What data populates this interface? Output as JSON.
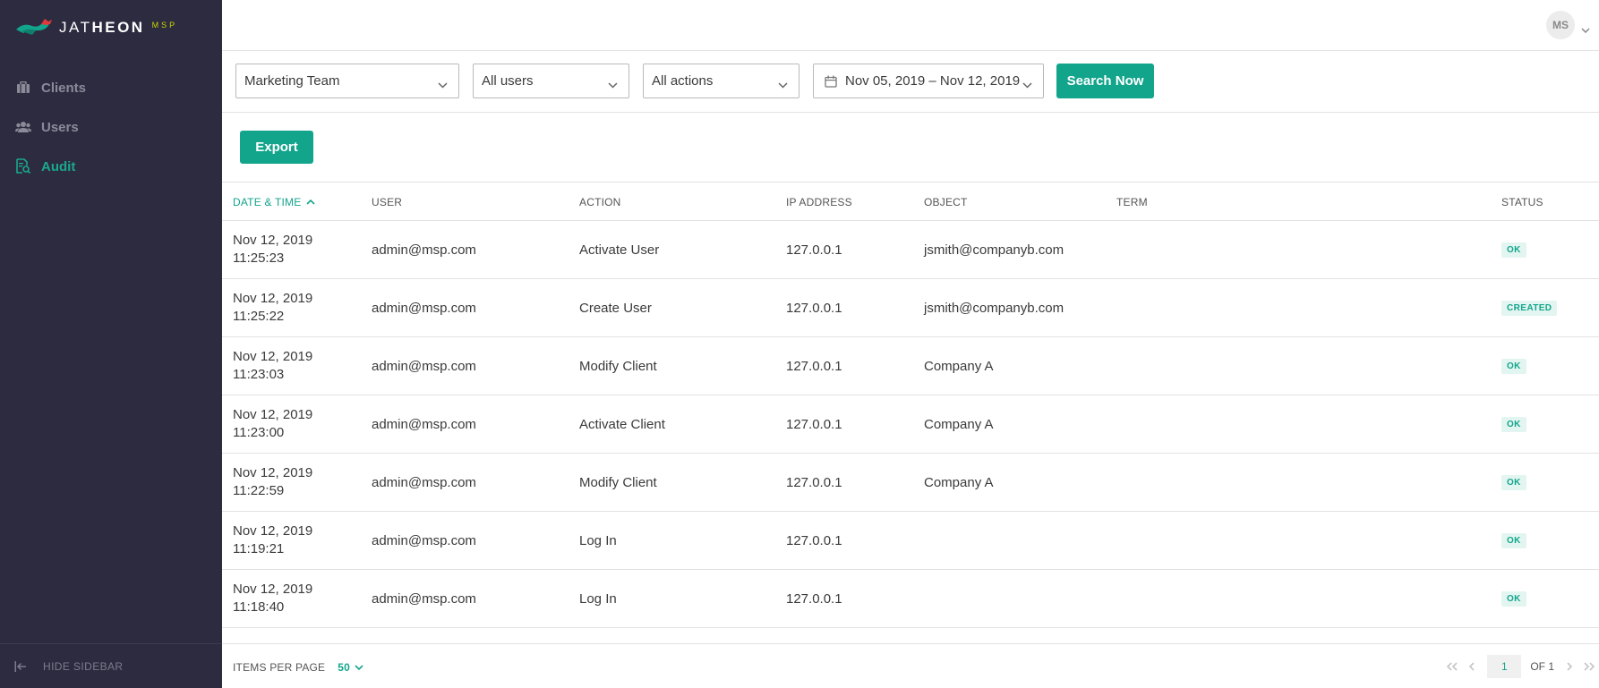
{
  "brand": {
    "name_light": "JAT",
    "name_bold": "HEON",
    "suffix": "MSP"
  },
  "sidebar": {
    "items": [
      {
        "label": "Clients",
        "icon": "briefcase-icon",
        "active": false
      },
      {
        "label": "Users",
        "icon": "users-icon",
        "active": false
      },
      {
        "label": "Audit",
        "icon": "audit-icon",
        "active": true
      }
    ],
    "hide_label": "HIDE SIDEBAR"
  },
  "header": {
    "avatar_initials": "MS"
  },
  "filters": {
    "team": "Marketing Team",
    "users": "All users",
    "actions": "All actions",
    "date_range": "Nov 05, 2019 – Nov 12, 2019",
    "search_label": "Search Now"
  },
  "toolbar": {
    "export_label": "Export"
  },
  "table": {
    "columns": [
      "DATE & TIME",
      "USER",
      "ACTION",
      "IP ADDRESS",
      "OBJECT",
      "TERM",
      "STATUS"
    ],
    "rows": [
      {
        "date": "Nov 12, 2019",
        "time": "11:25:23",
        "user": "admin@msp.com",
        "action": "Activate User",
        "ip": "127.0.0.1",
        "object": "jsmith@companyb.com",
        "term": "",
        "status": "OK"
      },
      {
        "date": "Nov 12, 2019",
        "time": "11:25:22",
        "user": "admin@msp.com",
        "action": "Create User",
        "ip": "127.0.0.1",
        "object": "jsmith@companyb.com",
        "term": "",
        "status": "CREATED"
      },
      {
        "date": "Nov 12, 2019",
        "time": "11:23:03",
        "user": "admin@msp.com",
        "action": "Modify Client",
        "ip": "127.0.0.1",
        "object": "Company A",
        "term": "",
        "status": "OK"
      },
      {
        "date": "Nov 12, 2019",
        "time": "11:23:00",
        "user": "admin@msp.com",
        "action": "Activate Client",
        "ip": "127.0.0.1",
        "object": "Company A",
        "term": "",
        "status": "OK"
      },
      {
        "date": "Nov 12, 2019",
        "time": "11:22:59",
        "user": "admin@msp.com",
        "action": "Modify Client",
        "ip": "127.0.0.1",
        "object": "Company A",
        "term": "",
        "status": "OK"
      },
      {
        "date": "Nov 12, 2019",
        "time": "11:19:21",
        "user": "admin@msp.com",
        "action": "Log In",
        "ip": "127.0.0.1",
        "object": "",
        "term": "",
        "status": "OK"
      },
      {
        "date": "Nov 12, 2019",
        "time": "11:18:40",
        "user": "admin@msp.com",
        "action": "Log In",
        "ip": "127.0.0.1",
        "object": "",
        "term": "",
        "status": "OK"
      }
    ]
  },
  "footer": {
    "items_per_page_label": "ITEMS PER PAGE",
    "items_per_page": "50",
    "page": "1",
    "of_label": "OF 1"
  },
  "colors": {
    "accent": "#12a58c",
    "sidebar_bg": "#2d2b40",
    "brand_yellow": "#c8d400",
    "brand_red": "#e03a3a"
  }
}
